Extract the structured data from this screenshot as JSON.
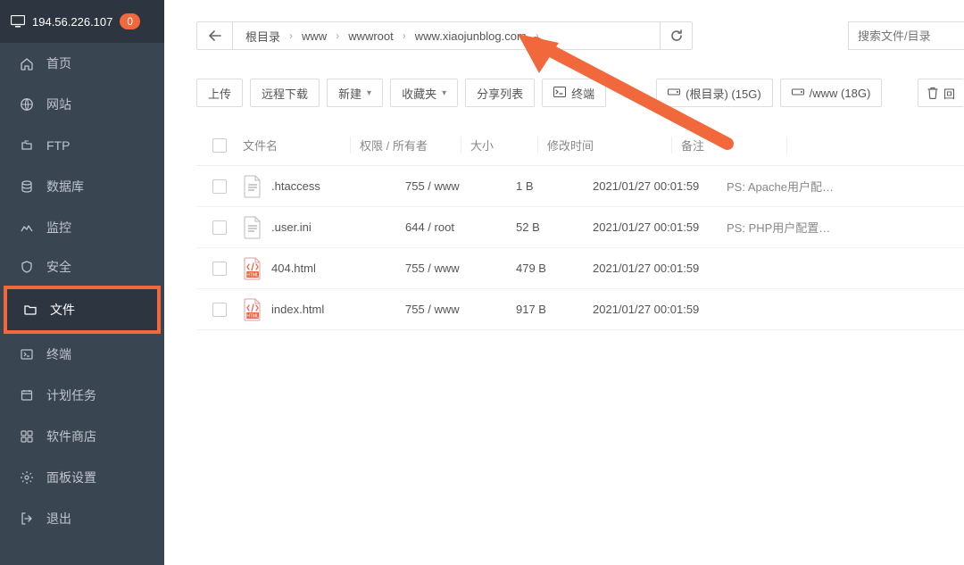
{
  "header": {
    "ip": "194.56.226.107",
    "notice_count": "0"
  },
  "sidebar": {
    "items": [
      {
        "label": "首页",
        "icon": "home-icon"
      },
      {
        "label": "网站",
        "icon": "globe-icon"
      },
      {
        "label": "FTP",
        "icon": "ftp-icon"
      },
      {
        "label": "数据库",
        "icon": "database-icon"
      },
      {
        "label": "监控",
        "icon": "monitor-icon"
      },
      {
        "label": "安全",
        "icon": "shield-icon"
      },
      {
        "label": "文件",
        "icon": "folder-icon"
      },
      {
        "label": "终端",
        "icon": "terminal-icon"
      },
      {
        "label": "计划任务",
        "icon": "calendar-icon"
      },
      {
        "label": "软件商店",
        "icon": "app-store-icon"
      },
      {
        "label": "面板设置",
        "icon": "gear-icon"
      },
      {
        "label": "退出",
        "icon": "exit-icon"
      }
    ]
  },
  "breadcrumb": {
    "segments": [
      "根目录",
      "www",
      "wwwroot",
      "www.xiaojunblog.com"
    ]
  },
  "search": {
    "placeholder": "搜索文件/目录"
  },
  "toolbar": {
    "upload": "上传",
    "remote_download": "远程下载",
    "new": "新建",
    "favorites": "收藏夹",
    "share_list": "分享列表",
    "terminal": "终端",
    "root_disk_label": "(根目录) (15G)",
    "www_disk_label": "/www (18G)",
    "recycle": "回"
  },
  "table": {
    "headers": {
      "filename": "文件名",
      "perm": "权限 / 所有者",
      "size": "大小",
      "mtime": "修改时间",
      "note": "备注"
    },
    "rows": [
      {
        "name": ".htaccess",
        "icon": "text-file",
        "perm": "755 / www",
        "size": "1 B",
        "mtime": "2021/01/27 00:01:59",
        "note": "PS: Apache用户配…"
      },
      {
        "name": ".user.ini",
        "icon": "text-file",
        "perm": "644 / root",
        "size": "52 B",
        "mtime": "2021/01/27 00:01:59",
        "note": "PS: PHP用户配置…"
      },
      {
        "name": "404.html",
        "icon": "html-file",
        "perm": "755 / www",
        "size": "479 B",
        "mtime": "2021/01/27 00:01:59",
        "note": ""
      },
      {
        "name": "index.html",
        "icon": "html-file",
        "perm": "755 / www",
        "size": "917 B",
        "mtime": "2021/01/27 00:01:59",
        "note": ""
      }
    ]
  },
  "colors": {
    "accent": "#f0683c"
  }
}
